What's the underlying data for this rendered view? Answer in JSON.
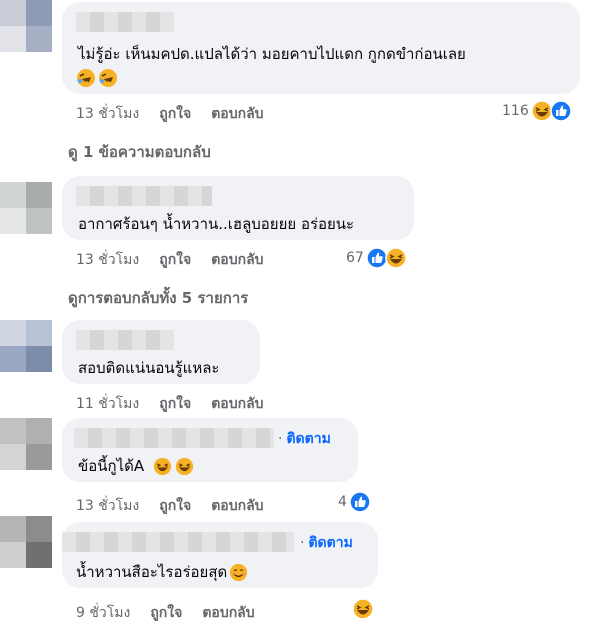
{
  "comments": [
    {
      "text": "ไม่รู้อ่ะ เห็นมคปด.แปลได้ว่า มอยคาบไปแดก กูกดขำก่อนเลย",
      "time": "13 ชั่วโมง",
      "like_label": "ถูกใจ",
      "reply_label": "ตอบกลับ",
      "reaction_count": "116"
    },
    {
      "text": "อากาศร้อนๆ น้ำหวาน..เฮลูบอยยย อร่อยนะ",
      "time": "13 ชั่วโมง",
      "like_label": "ถูกใจ",
      "reply_label": "ตอบกลับ",
      "reaction_count": "67"
    },
    {
      "text": "สอบติดแน่นอนรู้แหละ",
      "time": "11 ชั่วโมง",
      "like_label": "ถูกใจ",
      "reply_label": "ตอบกลับ"
    },
    {
      "follow_label": "ติดตาม",
      "text": "ข้อนี้กูได้A",
      "time": "13 ชั่วโมง",
      "like_label": "ถูกใจ",
      "reply_label": "ตอบกลับ",
      "reaction_count": "4"
    },
    {
      "follow_label": "ติดตาม",
      "text": "น้ำหวานสือะไรอร่อยสุด",
      "time": "9 ชั่วโมง",
      "like_label": "ถูกใจ",
      "reply_label": "ตอบกลับ"
    }
  ],
  "view_replies": [
    "ดู 1 ข้อความตอบกลับ",
    "ดูการตอบกลับทั้ง 5 รายการ"
  ],
  "colors": {
    "bubble": "#f0f2f5",
    "meta_text": "#65676b",
    "link_blue": "#0866ff",
    "like_blue": "#1877f2",
    "haha_yellow": "#f7b125"
  },
  "icons": [
    "rolling-laugh-icon",
    "haha-icon",
    "like-icon",
    "smile-icon"
  ]
}
